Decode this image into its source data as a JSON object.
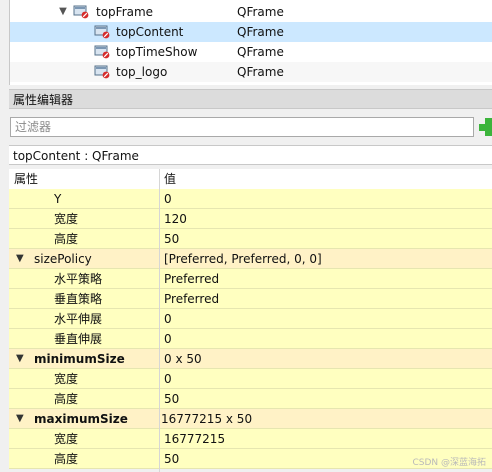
{
  "object_tree": {
    "rows": [
      {
        "name": "topFrame",
        "class": "QFrame",
        "expanded": true,
        "selected": false
      },
      {
        "name": "topContent",
        "class": "QFrame",
        "selected": true
      },
      {
        "name": "topTimeShow",
        "class": "QFrame",
        "selected": false
      },
      {
        "name": "top_logo",
        "class": "QFrame",
        "selected": false
      }
    ],
    "icon": "qframe-widget-icon"
  },
  "property_editor": {
    "title": "属性编辑器",
    "filter_placeholder": "过滤器",
    "add_icon": "green-plus-icon",
    "object_label": "topContent : QFrame",
    "header": {
      "property": "属性",
      "value": "值"
    },
    "rows": [
      {
        "name": "Y",
        "value": "0"
      },
      {
        "name": "宽度",
        "value": "120"
      },
      {
        "name": "高度",
        "value": "50"
      },
      {
        "name": "sizePolicy",
        "value": "[Preferred, Preferred, 0, 0]",
        "group": true,
        "bold": false
      },
      {
        "name": "水平策略",
        "value": "Preferred"
      },
      {
        "name": "垂直策略",
        "value": "Preferred"
      },
      {
        "name": "水平伸展",
        "value": "0"
      },
      {
        "name": "垂直伸展",
        "value": "0"
      },
      {
        "name": "minimumSize",
        "value": "0 x 50",
        "group": true,
        "bold": true
      },
      {
        "name": "宽度",
        "value": "0"
      },
      {
        "name": "高度",
        "value": "50"
      },
      {
        "name": "maximumSize",
        "value": "16777215 x 50",
        "group": true,
        "bold": true
      },
      {
        "name": "宽度",
        "value": "16777215"
      },
      {
        "name": "高度",
        "value": "50"
      }
    ]
  },
  "watermark": "CSDN @深蓝海拓",
  "colors": {
    "selected": "#cce8ff",
    "property_bg": "#ffffc0",
    "group_bg": "#fff2c6"
  }
}
